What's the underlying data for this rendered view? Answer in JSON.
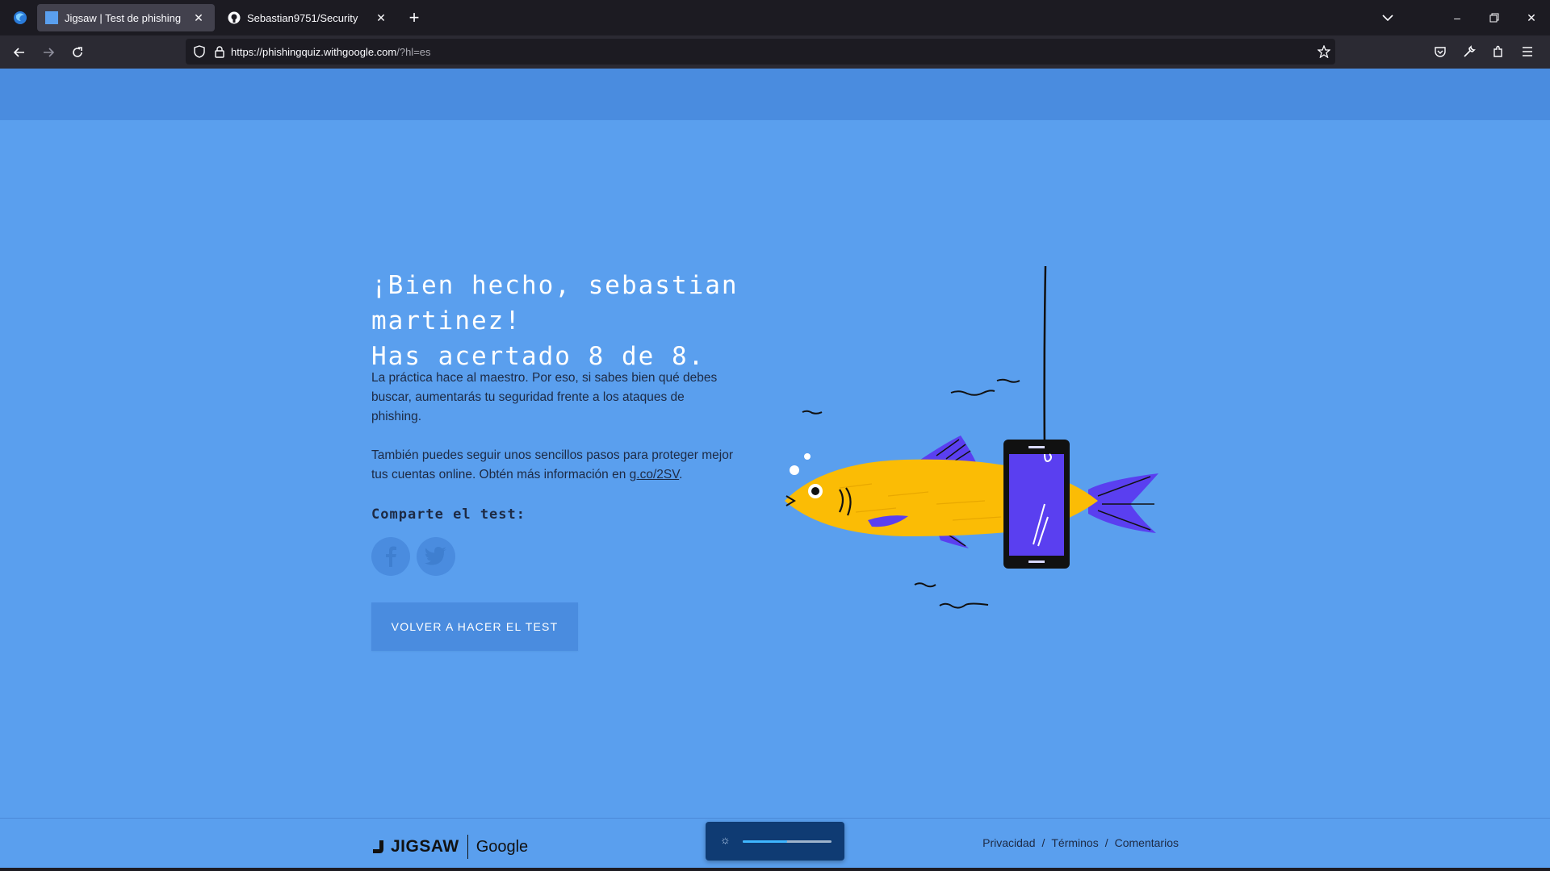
{
  "browser": {
    "tabs": [
      {
        "title": "Jigsaw | Test de phishing",
        "active": true
      },
      {
        "title": "Sebastian9751/Security",
        "active": false
      }
    ],
    "url": {
      "host": "https://phishingquiz.withgoogle.com",
      "rest": "/?hl=es"
    }
  },
  "result": {
    "headline_line1": "¡Bien hecho, sebastian martinez!",
    "headline_line2": "Has acertado 8 de 8.",
    "para1": "La práctica hace al maestro. Por eso, si sabes bien qué debes buscar, aumentarás tu seguridad frente a los ataques de phishing.",
    "para2_text": "También puedes seguir unos sencillos pasos para proteger mejor tus cuentas online. Obtén más información en ",
    "para2_link": "g.co/2SV",
    "para2_end": ".",
    "share_title": "Comparte el test:",
    "retry_label": "VOLVER A HACER EL TEST"
  },
  "footer": {
    "brand_jigsaw": "JIGSAW",
    "brand_google": "Google",
    "links": [
      "Privacidad",
      "Términos",
      "Comentarios"
    ],
    "separator": "/"
  },
  "popup": {
    "slider_level": 0.5
  },
  "colors": {
    "page_bg": "#5a9fee",
    "header_bg": "#4a8cdf",
    "fish_body": "#fbbc05",
    "fish_fins": "#5a3ff0",
    "phone_screen": "#5a3ff0"
  }
}
